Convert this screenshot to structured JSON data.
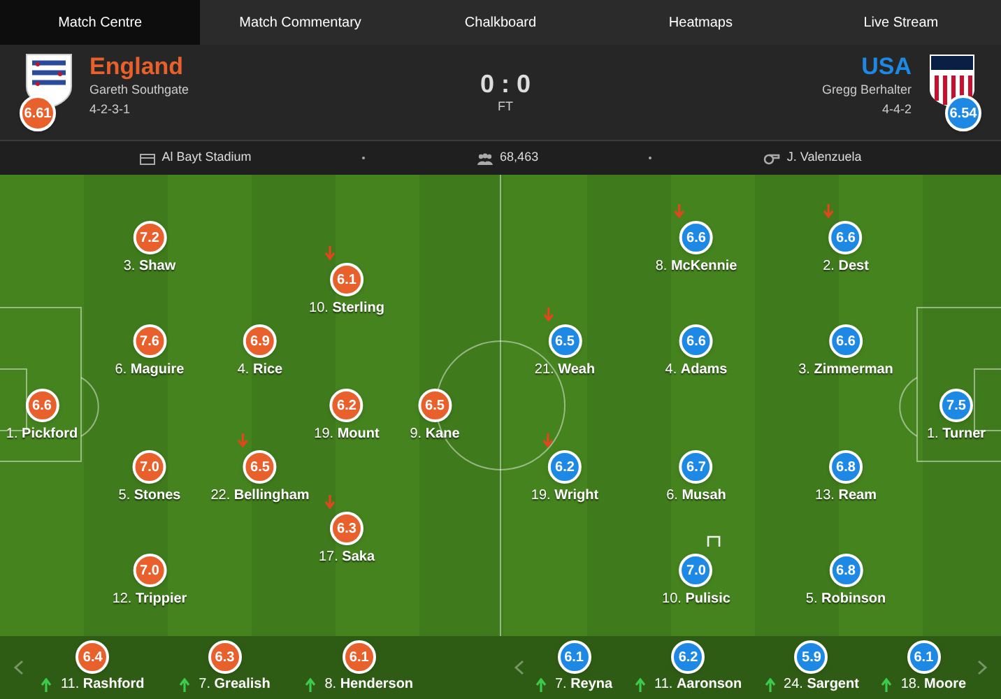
{
  "tabs": [
    {
      "label": "Match Centre",
      "selected": true
    },
    {
      "label": "Match Commentary",
      "selected": false
    },
    {
      "label": "Chalkboard",
      "selected": false
    },
    {
      "label": "Heatmaps",
      "selected": false
    },
    {
      "label": "Live Stream",
      "selected": false
    }
  ],
  "home": {
    "name": "England",
    "coach": "Gareth Southgate",
    "formation": "4-2-3-1",
    "rating": "6.61",
    "color": "#e8602c"
  },
  "away": {
    "name": "USA",
    "coach": "Gregg Berhalter",
    "formation": "4-4-2",
    "rating": "6.54",
    "color": "#1e88e5"
  },
  "score": "0 : 0",
  "status": "FT",
  "info": [
    {
      "kind": "stadium",
      "text": "Al Bayt Stadium"
    },
    {
      "kind": "attendance",
      "text": "68,463"
    },
    {
      "kind": "referee",
      "text": "J. Valenzuela"
    }
  ],
  "home_players": [
    {
      "label": "1. **Pickford**",
      "rating": "6.6",
      "subbed_off": false,
      "woodwork": false
    },
    {
      "label": "3. **Shaw**",
      "rating": "7.2",
      "subbed_off": false,
      "woodwork": false
    },
    {
      "label": "6. **Maguire**",
      "rating": "7.6",
      "subbed_off": false,
      "woodwork": false
    },
    {
      "label": "5. **Stones**",
      "rating": "7.0",
      "subbed_off": false,
      "woodwork": false
    },
    {
      "label": "12. **Trippier**",
      "rating": "7.0",
      "subbed_off": false,
      "woodwork": false
    },
    {
      "label": "4. **Rice**",
      "rating": "6.9",
      "subbed_off": false,
      "woodwork": false
    },
    {
      "label": "22. **Bellingham**",
      "rating": "6.5",
      "subbed_off": true,
      "woodwork": false
    },
    {
      "label": "10. **Sterling**",
      "rating": "6.1",
      "subbed_off": true,
      "woodwork": false
    },
    {
      "label": "19. **Mount**",
      "rating": "6.2",
      "subbed_off": false,
      "woodwork": false
    },
    {
      "label": "17. **Saka**",
      "rating": "6.3",
      "subbed_off": true,
      "woodwork": false
    },
    {
      "label": "9. **Kane**",
      "rating": "6.5",
      "subbed_off": false,
      "woodwork": false
    }
  ],
  "away_players": [
    {
      "label": "21. **Weah**",
      "rating": "6.5",
      "subbed_off": true,
      "woodwork": false
    },
    {
      "label": "19. **Wright**",
      "rating": "6.2",
      "subbed_off": true,
      "woodwork": false
    },
    {
      "label": "8. **McKennie**",
      "rating": "6.6",
      "subbed_off": true,
      "woodwork": false
    },
    {
      "label": "4. **Adams**",
      "rating": "6.6",
      "subbed_off": false,
      "woodwork": false
    },
    {
      "label": "6. **Musah**",
      "rating": "6.7",
      "subbed_off": false,
      "woodwork": false
    },
    {
      "label": "10. **Pulisic**",
      "rating": "7.0",
      "subbed_off": false,
      "woodwork": true
    },
    {
      "label": "2. **Dest**",
      "rating": "6.6",
      "subbed_off": true,
      "woodwork": false
    },
    {
      "label": "3. **Zimmerman**",
      "rating": "6.6",
      "subbed_off": false,
      "woodwork": false
    },
    {
      "label": "13. **Ream**",
      "rating": "6.8",
      "subbed_off": false,
      "woodwork": false
    },
    {
      "label": "5. **Robinson**",
      "rating": "6.8",
      "subbed_off": false,
      "woodwork": false
    },
    {
      "label": "1. **Turner**",
      "rating": "7.5",
      "subbed_off": false,
      "woodwork": false
    }
  ],
  "home_subs": [
    {
      "label": "11. **Rashford**",
      "rating": "6.4",
      "subbed_on": true
    },
    {
      "label": "7. **Grealish**",
      "rating": "6.3",
      "subbed_on": true
    },
    {
      "label": "8. **Henderson**",
      "rating": "6.1",
      "subbed_on": true
    }
  ],
  "away_subs": [
    {
      "label": "7. **Reyna**",
      "rating": "6.1",
      "subbed_on": true
    },
    {
      "label": "11. **Aaronson**",
      "rating": "6.2",
      "subbed_on": true
    },
    {
      "label": "24. **Sargent**",
      "rating": "5.9",
      "subbed_on": true
    },
    {
      "label": "18. **Moore**",
      "rating": "6.1",
      "subbed_on": true
    }
  ]
}
